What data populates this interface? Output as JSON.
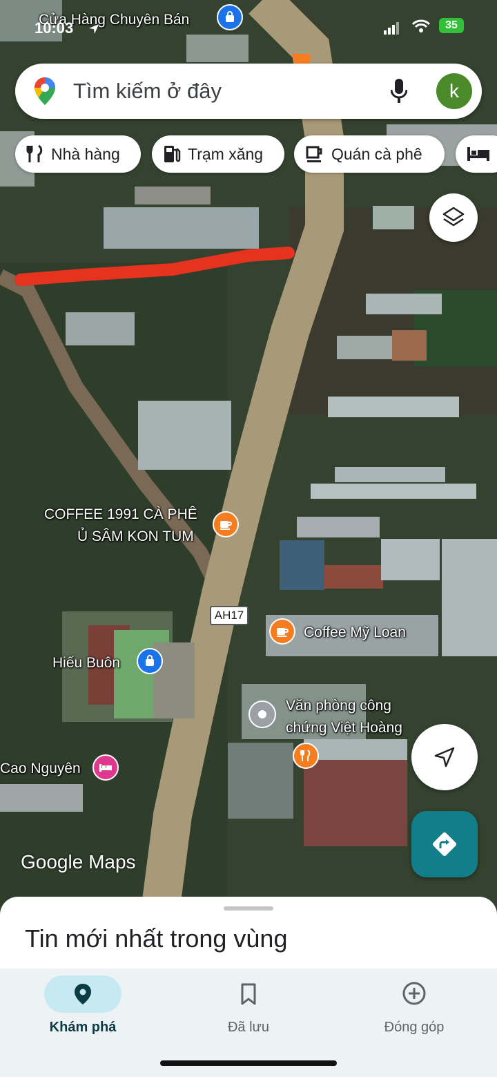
{
  "status_bar": {
    "time": "10:03",
    "battery": "35"
  },
  "search": {
    "placeholder": "Tìm kiếm ở đây",
    "avatar_letter": "k"
  },
  "chips": [
    {
      "label": "Nhà hàng",
      "icon": "restaurant-icon"
    },
    {
      "label": "Trạm xăng",
      "icon": "gas-station-icon"
    },
    {
      "label": "Quán cà phê",
      "icon": "coffee-icon"
    },
    {
      "label": "",
      "icon": "hotel-icon"
    }
  ],
  "map": {
    "road_label": "AH17",
    "places": {
      "top_store": "Cửa Hàng Chuyên Bán",
      "coffee_1991_line1": "COFFEE 1991 CÀ PHÊ",
      "coffee_1991_line2": "Ủ SÂM KON TUM",
      "coffee_my_loan": "Coffee Mỹ Loan",
      "hieu_buon": "Hiếu Buôn",
      "notary_line1": "Văn phòng công",
      "notary_line2": "chứng Việt Hoàng",
      "cao_nguyen": "Cao Nguyên"
    },
    "logo": "Google Maps"
  },
  "sheet": {
    "title": "Tin mới nhất trong vùng"
  },
  "bottom_nav": [
    {
      "label": "Khám phá",
      "icon": "explore-pin-icon",
      "active": true
    },
    {
      "label": "Đã lưu",
      "icon": "bookmark-icon",
      "active": false
    },
    {
      "label": "Đóng góp",
      "icon": "add-circle-icon",
      "active": false
    }
  ],
  "colors": {
    "accent": "#0f7a8a",
    "directions": "#127e8a",
    "marker_red": "#e5331f",
    "coffee_pin": "#f57c1f",
    "store_pin": "#1a73e8",
    "hotel_pin": "#e0388f"
  }
}
